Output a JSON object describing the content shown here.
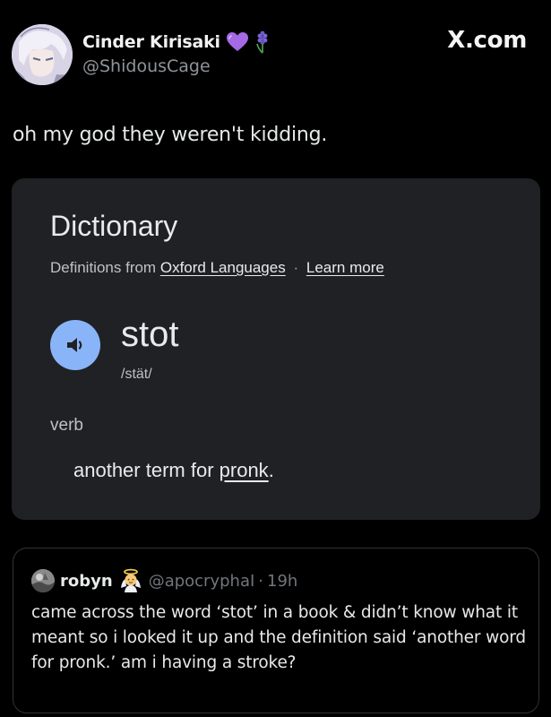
{
  "header": {
    "display_name": "Cinder Kirisaki",
    "handle": "@ShidousCage",
    "site": "X.com",
    "name_emojis": [
      "purple-heart-icon",
      "hyacinth-icon"
    ]
  },
  "tweet": {
    "text": "oh my god they weren't kidding."
  },
  "dictionary": {
    "title": "Dictionary",
    "source_prefix": "Definitions from",
    "source_link": "Oxford Languages",
    "separator": "·",
    "learn_more": "Learn more",
    "word": "stot",
    "pronunciation": "/stät/",
    "part_of_speech": "verb",
    "definition_prefix": "another term for ",
    "definition_link": "pronk",
    "definition_suffix": ".",
    "colors": {
      "card_bg": "#202124",
      "speaker_bg": "#8ab4f8"
    }
  },
  "quote": {
    "name": "robyn",
    "name_emoji": "angel-icon",
    "handle": "@apocryphaI",
    "dot": "·",
    "time": "19h",
    "text": "came across the word ‘stot’ in a book & didn’t know what it meant so i looked it up and the definition said ‘another word for pronk.’ am i having a stroke?"
  }
}
